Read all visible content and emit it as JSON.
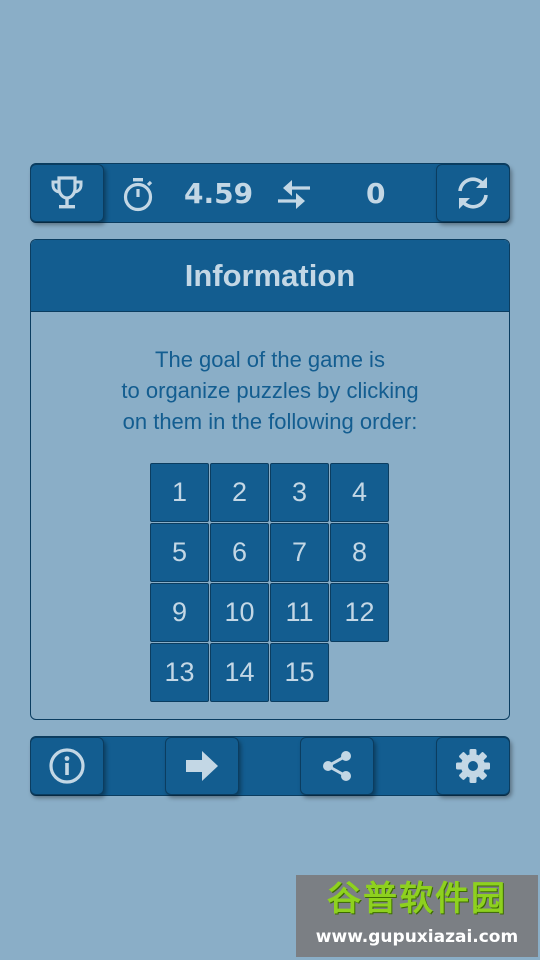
{
  "status_bar": {
    "time_value": "4.59",
    "moves_value": "0"
  },
  "icons": {
    "leaderboard": "trophy-icon",
    "timer": "stopwatch-icon",
    "moves": "swap-arrows-icon",
    "restart": "refresh-icon",
    "info": "info-icon",
    "next": "arrow-right-icon",
    "share": "share-icon",
    "settings": "gear-icon"
  },
  "info_panel": {
    "title": "Information",
    "text_lines": [
      "The goal of the game is",
      "to organize puzzles by clicking",
      "on them in the following order:"
    ]
  },
  "board": {
    "columns": 4,
    "tiles": [
      "1",
      "2",
      "3",
      "4",
      "5",
      "6",
      "7",
      "8",
      "9",
      "10",
      "11",
      "12",
      "13",
      "14",
      "15"
    ]
  },
  "colors": {
    "background": "#8aaec7",
    "accent": "#135d90",
    "text_light": "#c3d7e5",
    "border": "#0b3d60"
  },
  "watermark": {
    "title": "谷普软件园",
    "url": "www.gupuxiazai.com"
  }
}
